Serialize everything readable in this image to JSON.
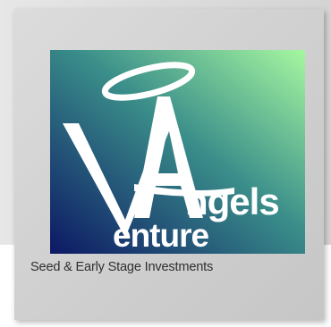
{
  "logo": {
    "word_top": "ngels",
    "word_bottom": "enture",
    "letter_a": "A",
    "letter_v": "V",
    "lettering": "Venture Angels",
    "colors": {
      "gradient_light": "#9cf29a",
      "gradient_mid": "#3a8e8a",
      "gradient_dark": "#0f1e66",
      "lettering": "#ffffff"
    }
  },
  "tagline": "Seed & Early Stage Investments",
  "colors": {
    "card_background": "#d0d0d0",
    "tagline_text": "#2f2f2f"
  }
}
